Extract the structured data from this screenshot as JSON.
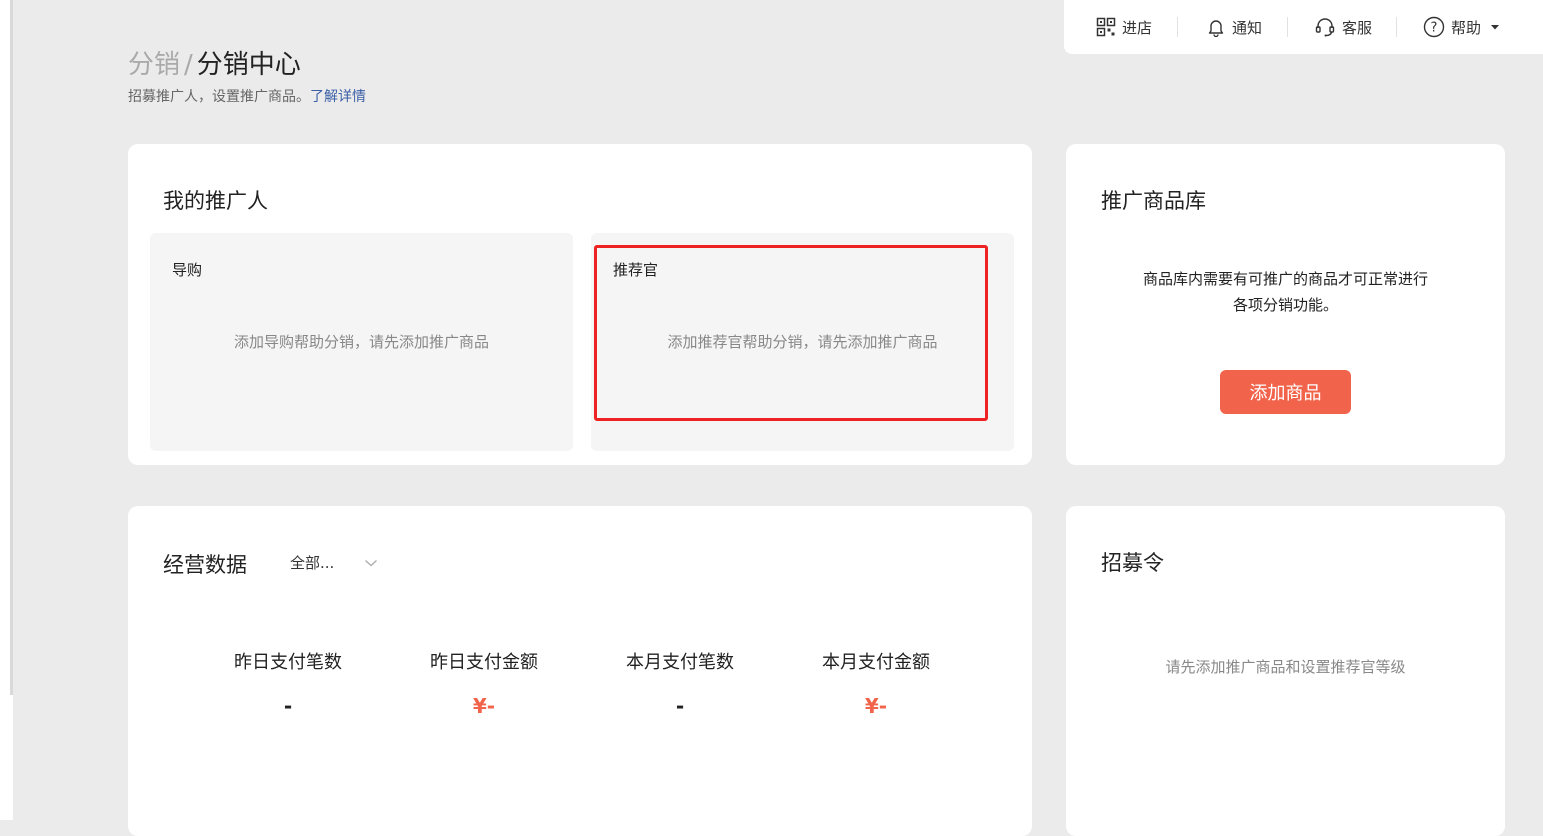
{
  "topbar": {
    "items": [
      {
        "label": "进店",
        "icon": "qrcode-icon"
      },
      {
        "label": "通知",
        "icon": "bell-icon"
      },
      {
        "label": "客服",
        "icon": "headset-icon"
      },
      {
        "label": "帮助",
        "icon": "help-circle-icon"
      }
    ]
  },
  "header": {
    "breadcrumb_parent": "分销",
    "breadcrumb_sep": "/",
    "title": "分销中心",
    "subtitle": "招募推广人，设置推广商品。",
    "learn_more": "了解详情"
  },
  "promoters": {
    "title": "我的推广人",
    "guide": {
      "label": "导购",
      "hint": "添加导购帮助分销，请先添加推广商品"
    },
    "recommender": {
      "label": "推荐官",
      "hint": "添加推荐官帮助分销，请先添加推广商品"
    }
  },
  "library": {
    "title": "推广商品库",
    "desc_line1": "商品库内需要有可推广的商品才可正常进行",
    "desc_line2": "各项分销功能。",
    "add_button": "添加商品"
  },
  "business": {
    "title": "经营数据",
    "filter_value": "全部...",
    "stats": [
      {
        "name": "昨日支付笔数",
        "value": "-"
      },
      {
        "name": "昨日支付金额",
        "value": "¥-"
      },
      {
        "name": "本月支付笔数",
        "value": "-"
      },
      {
        "name": "本月支付金额",
        "value": "¥-"
      }
    ]
  },
  "recruit": {
    "title": "招募令",
    "hint": "请先添加推广商品和设置推荐官等级"
  },
  "colors": {
    "accent": "#f2634b",
    "link": "#3b5fa7",
    "highlight_border": "#ee2222",
    "background": "#ebebeb"
  }
}
